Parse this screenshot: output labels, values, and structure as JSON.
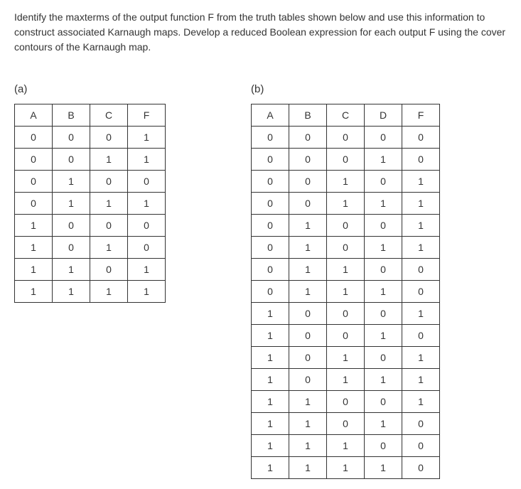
{
  "question": "Identify the maxterms of the output function F from the truth tables shown below and use this information to construct associated Karnaugh maps. Develop a reduced Boolean expression for each output F using the cover contours of the Karnaugh map.",
  "parts": {
    "a": {
      "label": "(a)",
      "headers": [
        "A",
        "B",
        "C",
        "F"
      ],
      "rows": [
        [
          "0",
          "0",
          "0",
          "1"
        ],
        [
          "0",
          "0",
          "1",
          "1"
        ],
        [
          "0",
          "1",
          "0",
          "0"
        ],
        [
          "0",
          "1",
          "1",
          "1"
        ],
        [
          "1",
          "0",
          "0",
          "0"
        ],
        [
          "1",
          "0",
          "1",
          "0"
        ],
        [
          "1",
          "1",
          "0",
          "1"
        ],
        [
          "1",
          "1",
          "1",
          "1"
        ]
      ]
    },
    "b": {
      "label": "(b)",
      "headers": [
        "A",
        "B",
        "C",
        "D",
        "F"
      ],
      "rows": [
        [
          "0",
          "0",
          "0",
          "0",
          "0"
        ],
        [
          "0",
          "0",
          "0",
          "1",
          "0"
        ],
        [
          "0",
          "0",
          "1",
          "0",
          "1"
        ],
        [
          "0",
          "0",
          "1",
          "1",
          "1"
        ],
        [
          "0",
          "1",
          "0",
          "0",
          "1"
        ],
        [
          "0",
          "1",
          "0",
          "1",
          "1"
        ],
        [
          "0",
          "1",
          "1",
          "0",
          "0"
        ],
        [
          "0",
          "1",
          "1",
          "1",
          "0"
        ],
        [
          "1",
          "0",
          "0",
          "0",
          "1"
        ],
        [
          "1",
          "0",
          "0",
          "1",
          "0"
        ],
        [
          "1",
          "0",
          "1",
          "0",
          "1"
        ],
        [
          "1",
          "0",
          "1",
          "1",
          "1"
        ],
        [
          "1",
          "1",
          "0",
          "0",
          "1"
        ],
        [
          "1",
          "1",
          "0",
          "1",
          "0"
        ],
        [
          "1",
          "1",
          "1",
          "0",
          "0"
        ],
        [
          "1",
          "1",
          "1",
          "1",
          "0"
        ]
      ]
    }
  }
}
